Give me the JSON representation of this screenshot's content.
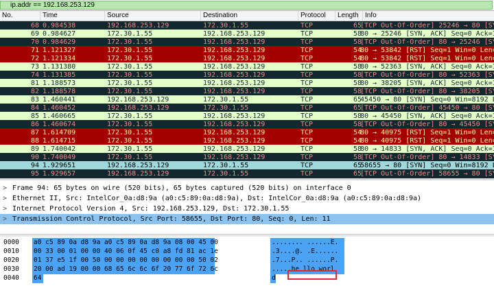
{
  "filter": {
    "value": "ip.addr == 192.168.253.129"
  },
  "columns": [
    "No.",
    "Time",
    "Source",
    "Destination",
    "Protocol",
    "Length",
    "Info"
  ],
  "packets": [
    {
      "no": "68",
      "time": "0.984538",
      "src": "192.168.253.129",
      "dst": "172.30.1.55",
      "proto": "TCP",
      "len": "65",
      "info": "[TCP Out-Of-Order] 25246 → 80 [SYN]",
      "style": "tcp-ooo"
    },
    {
      "no": "69",
      "time": "0.984627",
      "src": "172.30.1.55",
      "dst": "192.168.253.129",
      "proto": "TCP",
      "len": "58",
      "info": "80 → 25246 [SYN, ACK] Seq=0 Ack=1 W",
      "style": "tcp"
    },
    {
      "no": "70",
      "time": "0.984629",
      "src": "172.30.1.55",
      "dst": "192.168.253.129",
      "proto": "TCP",
      "len": "58",
      "info": "[TCP Out-Of-Order] 80 → 25246 [SYN,",
      "style": "tcp-ooo"
    },
    {
      "no": "71",
      "time": "1.121327",
      "src": "172.30.1.55",
      "dst": "192.168.253.129",
      "proto": "TCP",
      "len": "54",
      "info": "80 → 53842 [RST] Seq=1 Win=0 Len=0",
      "style": "rst"
    },
    {
      "no": "72",
      "time": "1.121334",
      "src": "172.30.1.55",
      "dst": "192.168.253.129",
      "proto": "TCP",
      "len": "54",
      "info": "80 → 53842 [RST] Seq=1 Win=0 Len=0",
      "style": "rst"
    },
    {
      "no": "73",
      "time": "1.131380",
      "src": "172.30.1.55",
      "dst": "192.168.253.129",
      "proto": "TCP",
      "len": "58",
      "info": "80 → 52363 [SYN, ACK] Seq=0 Ack=1 W",
      "style": "tcp"
    },
    {
      "no": "74",
      "time": "1.131385",
      "src": "172.30.1.55",
      "dst": "192.168.253.129",
      "proto": "TCP",
      "len": "58",
      "info": "[TCP Out-Of-Order] 80 → 52363 [SYN,",
      "style": "tcp-ooo"
    },
    {
      "no": "81",
      "time": "1.188573",
      "src": "172.30.1.55",
      "dst": "192.168.253.129",
      "proto": "TCP",
      "len": "58",
      "info": "80 → 38205 [SYN, ACK] Seq=0 Ack=1 W",
      "style": "tcp"
    },
    {
      "no": "82",
      "time": "1.188578",
      "src": "172.30.1.55",
      "dst": "192.168.253.129",
      "proto": "TCP",
      "len": "58",
      "info": "[TCP Out-Of-Order] 80 → 38205 [SYN,",
      "style": "tcp-ooo"
    },
    {
      "no": "83",
      "time": "1.460441",
      "src": "192.168.253.129",
      "dst": "172.30.1.55",
      "proto": "TCP",
      "len": "65",
      "info": "45450 → 80 [SYN] Seq=0 Win=8192 Len",
      "style": "tcp"
    },
    {
      "no": "84",
      "time": "1.460452",
      "src": "192.168.253.129",
      "dst": "172.30.1.55",
      "proto": "TCP",
      "len": "65",
      "info": "[TCP Out-Of-Order] 45450 → 80 [SYN]",
      "style": "tcp-ooo"
    },
    {
      "no": "85",
      "time": "1.460665",
      "src": "172.30.1.55",
      "dst": "192.168.253.129",
      "proto": "TCP",
      "len": "58",
      "info": "80 → 45450 [SYN, ACK] Seq=0 Ack=1 W",
      "style": "tcp"
    },
    {
      "no": "86",
      "time": "1.460674",
      "src": "172.30.1.55",
      "dst": "192.168.253.129",
      "proto": "TCP",
      "len": "58",
      "info": "[TCP Out-Of-Order] 80 → 45450 [SYN,",
      "style": "tcp-ooo"
    },
    {
      "no": "87",
      "time": "1.614709",
      "src": "172.30.1.55",
      "dst": "192.168.253.129",
      "proto": "TCP",
      "len": "54",
      "info": "80 → 40975 [RST] Seq=1 Win=0 Len=0",
      "style": "rst"
    },
    {
      "no": "88",
      "time": "1.614715",
      "src": "172.30.1.55",
      "dst": "192.168.253.129",
      "proto": "TCP",
      "len": "54",
      "info": "80 → 40975 [RST] Seq=1 Win=0 Len=0",
      "style": "rst"
    },
    {
      "no": "89",
      "time": "1.740042",
      "src": "172.30.1.55",
      "dst": "192.168.253.129",
      "proto": "TCP",
      "len": "58",
      "info": "80 → 14833 [SYN, ACK] Seq=0 Ack=1 W",
      "style": "tcp"
    },
    {
      "no": "90",
      "time": "1.740049",
      "src": "172.30.1.55",
      "dst": "192.168.253.129",
      "proto": "TCP",
      "len": "58",
      "info": "[TCP Out-Of-Order] 80 → 14833 [SYN,",
      "style": "tcp-ooo"
    },
    {
      "no": "94",
      "time": "1.929651",
      "src": "192.168.253.129",
      "dst": "172.30.1.55",
      "proto": "TCP",
      "len": "65",
      "info": "58655 → 80 [SYN] Seq=0 Win=8192 Len",
      "style": "sel"
    },
    {
      "no": "95",
      "time": "1.929657",
      "src": "192.168.253.129",
      "dst": "172.30.1.55",
      "proto": "TCP",
      "len": "65",
      "info": "[TCP Out-Of-Order] 58655 → 80 [SYN]",
      "style": "tcp-ooo"
    }
  ],
  "details": [
    {
      "arrow": ">",
      "text": "Frame 94: 65 bytes on wire (520 bits), 65 bytes captured (520 bits) on interface 0",
      "selected": false
    },
    {
      "arrow": ">",
      "text": "Ethernet II, Src: IntelCor_0a:d8:9a (a0:c5:89:0a:d8:9a), Dst: IntelCor_0a:d8:9a (a0:c5:89:0a:d8:9a)",
      "selected": false
    },
    {
      "arrow": ">",
      "text": "Internet Protocol Version 4, Src: 192.168.253.129, Dst: 172.30.1.55",
      "selected": false
    },
    {
      "arrow": ">",
      "text": "Transmission Control Protocol, Src Port: 58655, Dst Port: 80, Seq: 0, Len: 11",
      "selected": true
    }
  ],
  "bytes": [
    {
      "offset": "0000",
      "hex": "a0 c5 89 0a d8 9a a0 c5  89 0a d8 9a 08 00 45 00",
      "ascii": "........ ......E."
    },
    {
      "offset": "0010",
      "hex": "00 33 00 01 00 00 40 06  0f 45 c0 a8 fd 81 ac 1e",
      "ascii": ".3....@. .E......"
    },
    {
      "offset": "0020",
      "hex": "01 37 e5 1f 00 50 00 00  00 00 00 00 00 00 50 02",
      "ascii": ".7...P.. ......P."
    },
    {
      "offset": "0030",
      "hex": "20 00 ad 19 00 00 68 65  6c 6c 6f 20 77 6f 72 6c",
      "ascii": " .....he llo worl"
    },
    {
      "offset": "0040",
      "hex": "64",
      "ascii": "d"
    }
  ],
  "colors": {
    "ooo_bg": "#12272e",
    "ooo_fg": "#f78787",
    "tcp_bg": "#e4ffc7",
    "rst_bg": "#a40000",
    "rst_fg": "#fffc9c",
    "selected_row": "#a0d8dc",
    "detail_selected": "#8cc2ee",
    "byte_highlight": "#4aa3f5",
    "annotation_box": "#e8252a"
  }
}
